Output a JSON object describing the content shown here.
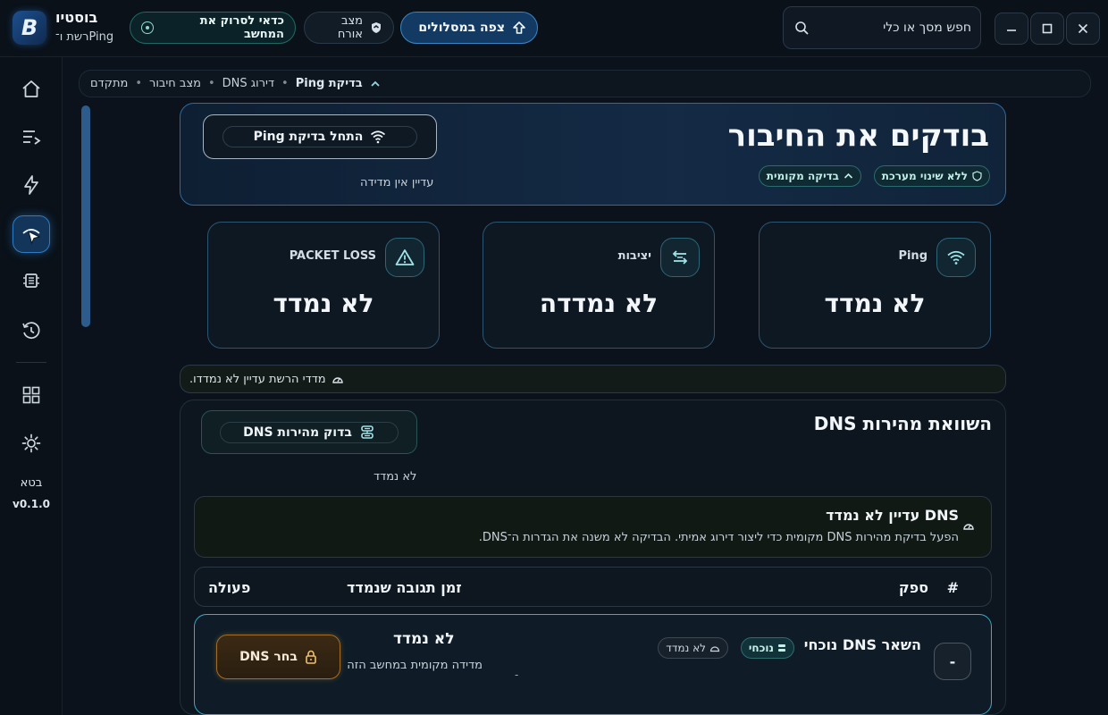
{
  "app": {
    "name": "בוסטיו",
    "subtitle": "רשת ו־Ping",
    "logo_letter": "B"
  },
  "header": {
    "scan_pill": "כדאי לסרוק את המחשב",
    "guest_pill": "מצב אורח",
    "view_button": "צפה במסלולים",
    "search_placeholder": "חפש מסך או כלי"
  },
  "sidebar": {
    "items": [
      {
        "icon": "home-icon"
      },
      {
        "icon": "list-icon"
      },
      {
        "icon": "lightning-icon"
      },
      {
        "icon": "network-cursor-icon",
        "active": true
      },
      {
        "icon": "chip-icon"
      },
      {
        "icon": "history-icon"
      },
      {
        "icon": "grid-icon"
      },
      {
        "icon": "settings-icon"
      }
    ],
    "beta_label": "בטא",
    "version": "v0.1.0"
  },
  "breadcrumb": {
    "items": [
      "בדיקת Ping",
      "דירוג DNS",
      "מצב חיבור",
      "מתקדם"
    ]
  },
  "hero": {
    "title": "בודקים את החיבור",
    "tag_local": "בדיקה מקומית",
    "tag_nochange": "ללא שינוי מערכת",
    "start_button": "התחל בדיקת Ping",
    "status": "עדיין אין מדידה"
  },
  "metrics": [
    {
      "label": "Ping",
      "value": "לא נמדד",
      "icon": "wifi-icon"
    },
    {
      "label": "יציבות",
      "value": "לא נמדדה",
      "icon": "arrows-icon"
    },
    {
      "label": "PACKET LOSS",
      "value": "לא נמדד",
      "icon": "warning-icon"
    }
  ],
  "info_strip": "מדדי הרשת עדיין לא נמדדו.",
  "dns": {
    "title": "השוואת מהירות DNS",
    "test_button": "בדוק מהירות DNS",
    "status": "לא נמדד",
    "notice_title": "DNS עדיין לא נמדד",
    "notice_desc": "הפעל בדיקת מהירות DNS מקומית כדי ליצור דירוג אמיתי. הבדיקה לא משנה את הגדרות ה־DNS.",
    "columns": {
      "idx": "#",
      "provider": "ספק",
      "response": "זמן תגובה שנמדד",
      "action": "פעולה"
    },
    "rows": [
      {
        "idx": "-",
        "name": "השאר DNS נוכחי",
        "chip_current": "נוכחי",
        "chip_status": "לא נמדד",
        "dash": "-",
        "value": "לא נמדד",
        "value_sub": "מדידה מקומית במחשב הזה",
        "action": "בחר DNS"
      }
    ]
  },
  "colors": {
    "accent_blue": "#3b86c6",
    "accent_teal": "#2e6c6d",
    "accent_gold": "#a36d28",
    "background": "#0b121b"
  }
}
